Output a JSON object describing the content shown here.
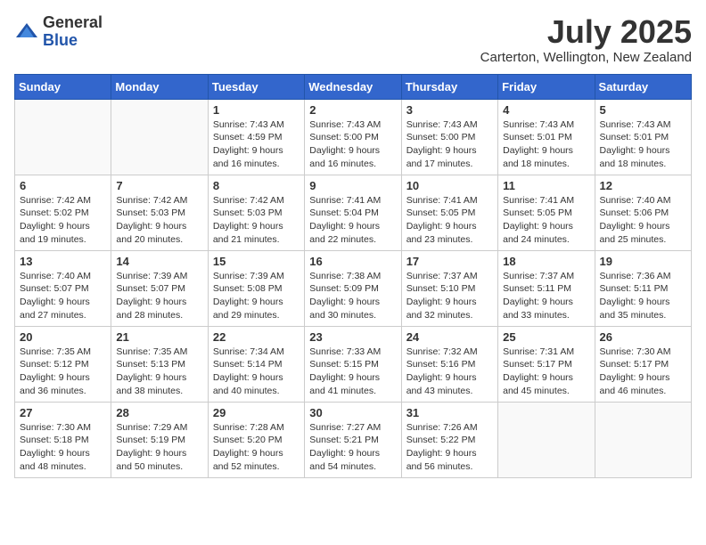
{
  "logo": {
    "general": "General",
    "blue": "Blue"
  },
  "title": {
    "month": "July 2025",
    "location": "Carterton, Wellington, New Zealand"
  },
  "weekdays": [
    "Sunday",
    "Monday",
    "Tuesday",
    "Wednesday",
    "Thursday",
    "Friday",
    "Saturday"
  ],
  "weeks": [
    [
      {
        "day": "",
        "info": ""
      },
      {
        "day": "",
        "info": ""
      },
      {
        "day": "1",
        "info": "Sunrise: 7:43 AM\nSunset: 4:59 PM\nDaylight: 9 hours\nand 16 minutes."
      },
      {
        "day": "2",
        "info": "Sunrise: 7:43 AM\nSunset: 5:00 PM\nDaylight: 9 hours\nand 16 minutes."
      },
      {
        "day": "3",
        "info": "Sunrise: 7:43 AM\nSunset: 5:00 PM\nDaylight: 9 hours\nand 17 minutes."
      },
      {
        "day": "4",
        "info": "Sunrise: 7:43 AM\nSunset: 5:01 PM\nDaylight: 9 hours\nand 18 minutes."
      },
      {
        "day": "5",
        "info": "Sunrise: 7:43 AM\nSunset: 5:01 PM\nDaylight: 9 hours\nand 18 minutes."
      }
    ],
    [
      {
        "day": "6",
        "info": "Sunrise: 7:42 AM\nSunset: 5:02 PM\nDaylight: 9 hours\nand 19 minutes."
      },
      {
        "day": "7",
        "info": "Sunrise: 7:42 AM\nSunset: 5:03 PM\nDaylight: 9 hours\nand 20 minutes."
      },
      {
        "day": "8",
        "info": "Sunrise: 7:42 AM\nSunset: 5:03 PM\nDaylight: 9 hours\nand 21 minutes."
      },
      {
        "day": "9",
        "info": "Sunrise: 7:41 AM\nSunset: 5:04 PM\nDaylight: 9 hours\nand 22 minutes."
      },
      {
        "day": "10",
        "info": "Sunrise: 7:41 AM\nSunset: 5:05 PM\nDaylight: 9 hours\nand 23 minutes."
      },
      {
        "day": "11",
        "info": "Sunrise: 7:41 AM\nSunset: 5:05 PM\nDaylight: 9 hours\nand 24 minutes."
      },
      {
        "day": "12",
        "info": "Sunrise: 7:40 AM\nSunset: 5:06 PM\nDaylight: 9 hours\nand 25 minutes."
      }
    ],
    [
      {
        "day": "13",
        "info": "Sunrise: 7:40 AM\nSunset: 5:07 PM\nDaylight: 9 hours\nand 27 minutes."
      },
      {
        "day": "14",
        "info": "Sunrise: 7:39 AM\nSunset: 5:07 PM\nDaylight: 9 hours\nand 28 minutes."
      },
      {
        "day": "15",
        "info": "Sunrise: 7:39 AM\nSunset: 5:08 PM\nDaylight: 9 hours\nand 29 minutes."
      },
      {
        "day": "16",
        "info": "Sunrise: 7:38 AM\nSunset: 5:09 PM\nDaylight: 9 hours\nand 30 minutes."
      },
      {
        "day": "17",
        "info": "Sunrise: 7:37 AM\nSunset: 5:10 PM\nDaylight: 9 hours\nand 32 minutes."
      },
      {
        "day": "18",
        "info": "Sunrise: 7:37 AM\nSunset: 5:11 PM\nDaylight: 9 hours\nand 33 minutes."
      },
      {
        "day": "19",
        "info": "Sunrise: 7:36 AM\nSunset: 5:11 PM\nDaylight: 9 hours\nand 35 minutes."
      }
    ],
    [
      {
        "day": "20",
        "info": "Sunrise: 7:35 AM\nSunset: 5:12 PM\nDaylight: 9 hours\nand 36 minutes."
      },
      {
        "day": "21",
        "info": "Sunrise: 7:35 AM\nSunset: 5:13 PM\nDaylight: 9 hours\nand 38 minutes."
      },
      {
        "day": "22",
        "info": "Sunrise: 7:34 AM\nSunset: 5:14 PM\nDaylight: 9 hours\nand 40 minutes."
      },
      {
        "day": "23",
        "info": "Sunrise: 7:33 AM\nSunset: 5:15 PM\nDaylight: 9 hours\nand 41 minutes."
      },
      {
        "day": "24",
        "info": "Sunrise: 7:32 AM\nSunset: 5:16 PM\nDaylight: 9 hours\nand 43 minutes."
      },
      {
        "day": "25",
        "info": "Sunrise: 7:31 AM\nSunset: 5:17 PM\nDaylight: 9 hours\nand 45 minutes."
      },
      {
        "day": "26",
        "info": "Sunrise: 7:30 AM\nSunset: 5:17 PM\nDaylight: 9 hours\nand 46 minutes."
      }
    ],
    [
      {
        "day": "27",
        "info": "Sunrise: 7:30 AM\nSunset: 5:18 PM\nDaylight: 9 hours\nand 48 minutes."
      },
      {
        "day": "28",
        "info": "Sunrise: 7:29 AM\nSunset: 5:19 PM\nDaylight: 9 hours\nand 50 minutes."
      },
      {
        "day": "29",
        "info": "Sunrise: 7:28 AM\nSunset: 5:20 PM\nDaylight: 9 hours\nand 52 minutes."
      },
      {
        "day": "30",
        "info": "Sunrise: 7:27 AM\nSunset: 5:21 PM\nDaylight: 9 hours\nand 54 minutes."
      },
      {
        "day": "31",
        "info": "Sunrise: 7:26 AM\nSunset: 5:22 PM\nDaylight: 9 hours\nand 56 minutes."
      },
      {
        "day": "",
        "info": ""
      },
      {
        "day": "",
        "info": ""
      }
    ]
  ]
}
